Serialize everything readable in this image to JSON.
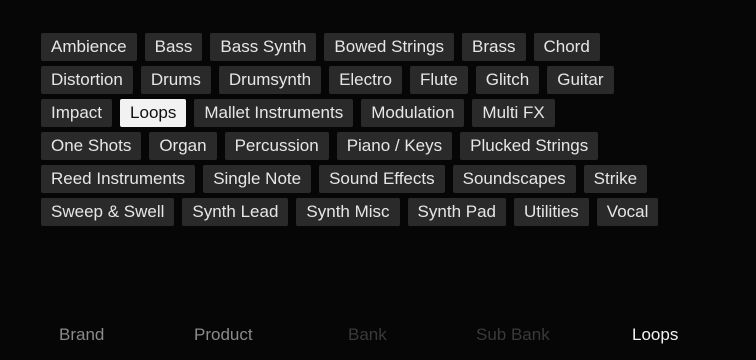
{
  "tags": {
    "rows": [
      [
        {
          "label": "Ambience",
          "selected": false
        },
        {
          "label": "Bass",
          "selected": false
        },
        {
          "label": "Bass Synth",
          "selected": false
        },
        {
          "label": "Bowed Strings",
          "selected": false
        },
        {
          "label": "Brass",
          "selected": false
        },
        {
          "label": "Chord",
          "selected": false
        }
      ],
      [
        {
          "label": "Distortion",
          "selected": false
        },
        {
          "label": "Drums",
          "selected": false
        },
        {
          "label": "Drumsynth",
          "selected": false
        },
        {
          "label": "Electro",
          "selected": false
        },
        {
          "label": "Flute",
          "selected": false
        },
        {
          "label": "Glitch",
          "selected": false
        },
        {
          "label": "Guitar",
          "selected": false
        }
      ],
      [
        {
          "label": "Impact",
          "selected": false
        },
        {
          "label": "Loops",
          "selected": true
        },
        {
          "label": "Mallet Instruments",
          "selected": false
        },
        {
          "label": "Modulation",
          "selected": false
        },
        {
          "label": "Multi FX",
          "selected": false
        }
      ],
      [
        {
          "label": "One Shots",
          "selected": false
        },
        {
          "label": "Organ",
          "selected": false
        },
        {
          "label": "Percussion",
          "selected": false
        },
        {
          "label": "Piano / Keys",
          "selected": false
        },
        {
          "label": "Plucked Strings",
          "selected": false
        }
      ],
      [
        {
          "label": "Reed Instruments",
          "selected": false
        },
        {
          "label": "Single Note",
          "selected": false
        },
        {
          "label": "Sound Effects",
          "selected": false
        },
        {
          "label": "Soundscapes",
          "selected": false
        },
        {
          "label": "Strike",
          "selected": false
        }
      ],
      [
        {
          "label": "Sweep & Swell",
          "selected": false
        },
        {
          "label": "Synth Lead",
          "selected": false
        },
        {
          "label": "Synth Misc",
          "selected": false
        },
        {
          "label": "Synth Pad",
          "selected": false
        },
        {
          "label": "Utilities",
          "selected": false
        },
        {
          "label": "Vocal",
          "selected": false
        }
      ]
    ]
  },
  "footer": {
    "brand": "Brand",
    "product": "Product",
    "bank": "Bank",
    "sub_bank": "Sub Bank",
    "type": "Loops"
  },
  "colors": {
    "background": "#060606",
    "tag_bg": "#2a2a2a",
    "tag_selected_bg": "#f2f2f2",
    "crumb_active": "#f2f2f2",
    "crumb_inactive": "#8a8a8a",
    "crumb_disabled": "#3a3a3a"
  }
}
